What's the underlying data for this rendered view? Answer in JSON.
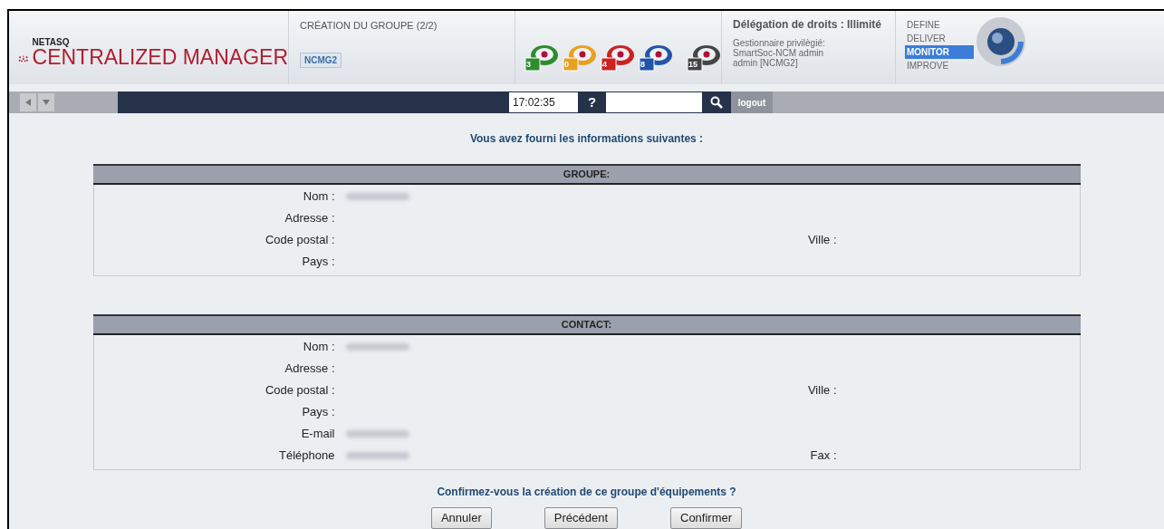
{
  "header": {
    "brand_small": "NETASQ",
    "brand": "CENTRALIZED MANAGER",
    "page_title": "CRÉATION DU GROUPE (2/2)",
    "server_tag": "NCMG2",
    "status_icons": [
      {
        "count": "3",
        "color": "#2e8b2e"
      },
      {
        "count": "0",
        "color": "#e8a020"
      },
      {
        "count": "4",
        "color": "#cc2222"
      },
      {
        "count": "8",
        "color": "#2255aa"
      },
      {
        "count": "15",
        "color": "#444444"
      }
    ],
    "delegation": "Délégation de droits : Illimité",
    "user_lines": [
      "Gestionnaire privilègié:",
      "SmartSoc-NCM admin",
      "admin [NCMG2]"
    ],
    "modes": [
      {
        "label": "DEFINE",
        "selected": false
      },
      {
        "label": "DELIVER",
        "selected": false
      },
      {
        "label": "MONITOR",
        "selected": true
      },
      {
        "label": "IMPROVE",
        "selected": false
      }
    ]
  },
  "toolbar": {
    "time": "17:02:35",
    "help": "?",
    "logout": "logout"
  },
  "intro": "Vous avez fourni les informations suivantes :",
  "sections": [
    {
      "title": "GROUPE:",
      "rows": [
        {
          "label": "Nom :",
          "redacted": true
        },
        {
          "label": "Adresse :",
          "redacted": false
        },
        {
          "label": "Code postal :",
          "redacted": false,
          "right_label": "Ville :"
        },
        {
          "label": "Pays :",
          "redacted": false
        }
      ]
    },
    {
      "title": "CONTACT:",
      "rows": [
        {
          "label": "Nom :",
          "redacted": true
        },
        {
          "label": "Adresse :",
          "redacted": false
        },
        {
          "label": "Code postal :",
          "redacted": false,
          "right_label": "Ville :"
        },
        {
          "label": "Pays :",
          "redacted": false
        },
        {
          "label": "E-mail",
          "redacted": true
        },
        {
          "label": "Téléphone",
          "redacted": true,
          "right_label": "Fax :"
        }
      ]
    }
  ],
  "question": "Confirmez-vous la création de ce groupe d'équipements ?",
  "buttons": [
    "Annuler",
    "Précédent",
    "Confirmer"
  ]
}
